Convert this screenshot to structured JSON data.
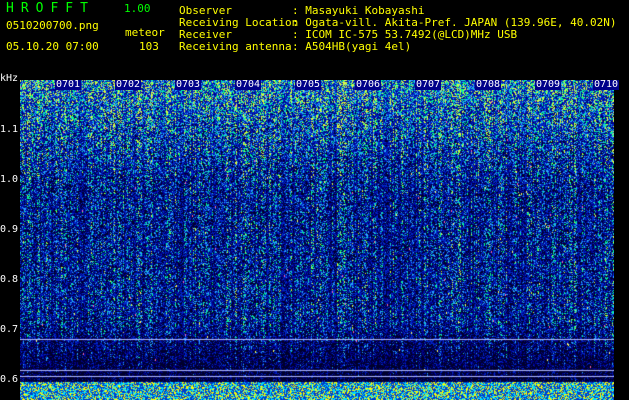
{
  "header": {
    "app_title": "HROFFT",
    "app_version": "1.00",
    "filename": "0510200700.png",
    "meteor_label": "meteor",
    "timestamp": "05.10.20 07:00",
    "meteor_count": "103"
  },
  "info": [
    {
      "label": "Observer",
      "value": ": Masayuki Kobayashi"
    },
    {
      "label": "Receiving Location",
      "value": ": Ogata-vill. Akita-Pref. JAPAN (139.96E, 40.02N)"
    },
    {
      "label": "Receiver",
      "value": ": ICOM IC-575 53.7492(@LCD)MHz USB"
    },
    {
      "label": "Receiving antenna",
      "value": ": A504HB(yagi 4el)"
    }
  ],
  "spectrogram": {
    "y_unit": "kHz",
    "y_ticks": [
      "1.1",
      "1.0",
      "0.9",
      "0.8",
      "0.7",
      "0.6"
    ],
    "time_labels": [
      "0701",
      "0702",
      "0703",
      "0704",
      "0705",
      "0706",
      "0707",
      "0708",
      "0709",
      "0710"
    ],
    "colors": {
      "background": "#000000",
      "low": "#0000b4",
      "mid": "#2ca0ff",
      "high": "#00ff88",
      "peak": "#ffff00",
      "axis_text": "#ffffff",
      "header_green": "#00ff00",
      "header_yellow": "#ffff00"
    }
  }
}
